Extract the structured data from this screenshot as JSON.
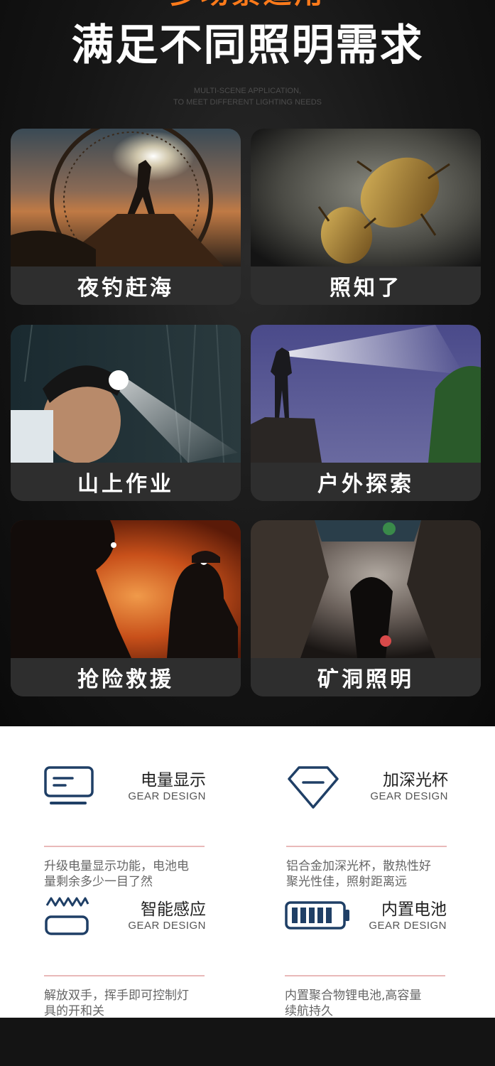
{
  "header": {
    "headline_top": "多场景适用",
    "headline_main": "满足不同照明需求",
    "subtitle_line1": "MULTI-SCENE APPLICATION,",
    "subtitle_line2": "TO MEET DIFFERENT LIGHTING NEEDS"
  },
  "scenes": [
    {
      "label": "夜钓赶海",
      "image": "night-fishing-boat-photo"
    },
    {
      "label": "照知了",
      "image": "cicada-on-tree-photo"
    },
    {
      "label": "山上作业",
      "image": "headlamp-worker-photo"
    },
    {
      "label": "户外探索",
      "image": "hiker-cliff-photo"
    },
    {
      "label": "抢险救援",
      "image": "fire-rescue-photo"
    },
    {
      "label": "矿洞照明",
      "image": "cave-exploration-photo"
    }
  ],
  "features": [
    {
      "title": "电量显示",
      "subtitle": "GEAR DESIGN",
      "icon": "display-icon",
      "desc_line1": "升级电量显示功能，电池电",
      "desc_line2": "量剩余多少一目了然"
    },
    {
      "title": "加深光杯",
      "subtitle": "GEAR DESIGN",
      "icon": "reflector-cup-icon",
      "desc_line1": "铝合金加深光杯，散热性好",
      "desc_line2": "聚光性佳，照射距离远"
    },
    {
      "title": "智能感应",
      "subtitle": "GEAR DESIGN",
      "icon": "sensor-wave-icon",
      "desc_line1": "解放双手，挥手即可控制灯",
      "desc_line2": "具的开和关"
    },
    {
      "title": "内置电池",
      "subtitle": "GEAR DESIGN",
      "icon": "battery-icon",
      "desc_line1": "内置聚合物锂电池,高容量",
      "desc_line2": "续航持久"
    }
  ],
  "colors": {
    "accent_orange": "#ff7a1a",
    "icon_blue": "#1f3f66",
    "rule_pink": "#e9b9b9"
  }
}
